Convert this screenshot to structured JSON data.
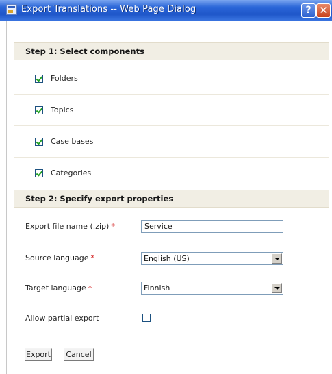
{
  "window": {
    "title": "Export Translations -- Web Page Dialog",
    "help_label": "?",
    "close_label": "✕"
  },
  "step1": {
    "title": "Step 1: Select components",
    "items": [
      {
        "label": "Folders",
        "checked": true
      },
      {
        "label": "Topics",
        "checked": true
      },
      {
        "label": "Case bases",
        "checked": true
      },
      {
        "label": "Categories",
        "checked": true
      }
    ]
  },
  "step2": {
    "title": "Step 2: Specify export properties",
    "file_name": {
      "label": "Export file name (.zip)",
      "required_mark": "*",
      "value": "Service"
    },
    "source_language": {
      "label": "Source language",
      "required_mark": "*",
      "value": "English (US)"
    },
    "target_language": {
      "label": "Target language",
      "required_mark": "*",
      "value": "Finnish"
    },
    "partial_export": {
      "label": "Allow partial export",
      "checked": false
    }
  },
  "buttons": {
    "export": {
      "mnemonic": "E",
      "rest": "xport"
    },
    "cancel": {
      "mnemonic": "C",
      "rest": "ancel"
    }
  },
  "colors": {
    "titlebar": "#2a66d8",
    "section_header_bg": "#f1eee4",
    "required": "#d21b1b",
    "checkmark": "#21a121"
  }
}
